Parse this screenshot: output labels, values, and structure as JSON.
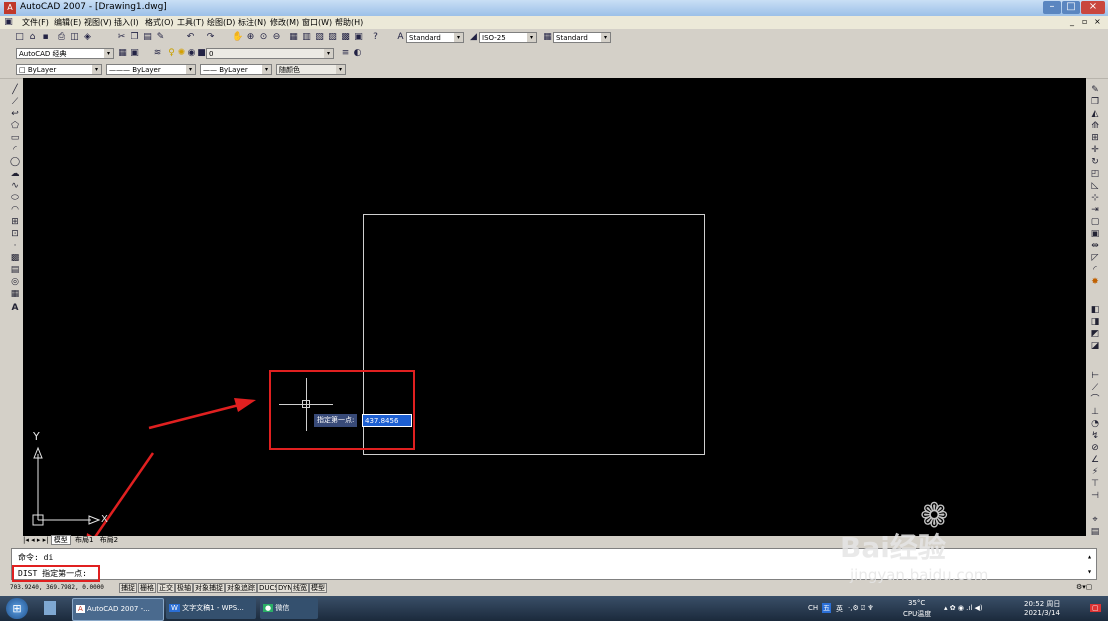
{
  "window": {
    "title": "AutoCAD 2007 - [Drawing1.dwg]"
  },
  "menu": [
    "文件(F)",
    "编辑(E)",
    "视图(V)",
    "插入(I)",
    "格式(O)",
    "工具(T)",
    "绘图(D)",
    "标注(N)",
    "修改(M)",
    "窗口(W)",
    "帮助(H)"
  ],
  "styles": {
    "text_style": "Standard",
    "dim_style": "ISO-25",
    "table_style": "Standard"
  },
  "workspace": {
    "name": "AutoCAD 经典",
    "layer": "0"
  },
  "properties": {
    "color": "ByLayer",
    "linetype": "ByLayer",
    "lineweight": "ByLayer",
    "plot_style": "随颜色"
  },
  "canvas": {
    "prompt_label": "指定第一点:",
    "prompt_value": "437.8456",
    "ucs_y": "Y",
    "ucs_x": "X"
  },
  "layout_tabs": {
    "model": "模型",
    "layout1": "布局1",
    "layout2": "布局2"
  },
  "command": {
    "line1": "命令: di",
    "line2": "DIST 指定第一点:"
  },
  "status": {
    "coords": "703.9240, 369.7982, 0.0000",
    "toggles": [
      "捕捉",
      "栅格",
      "正交",
      "极轴",
      "对象捕捉",
      "对象追踪",
      "DUCS",
      "DYN",
      "线宽",
      "模型"
    ]
  },
  "taskbar": {
    "items": [
      "AutoCAD 2007 -...",
      "文字文稿1 - WPS...",
      "微信"
    ],
    "tray_lang": "CH",
    "tray_ime": "英",
    "temperature": "35°C",
    "cpu_label": "CPU温度",
    "time": "20:52 周日",
    "date": "2021/3/14"
  },
  "watermark": {
    "brand": "Bai经验",
    "url": "jingyan.baidu.com"
  },
  "colors": {
    "canvas": "#000000",
    "highlight": "#e02020",
    "taskbar": "#1b2a3c",
    "selected_value": "#1d5fd1"
  }
}
